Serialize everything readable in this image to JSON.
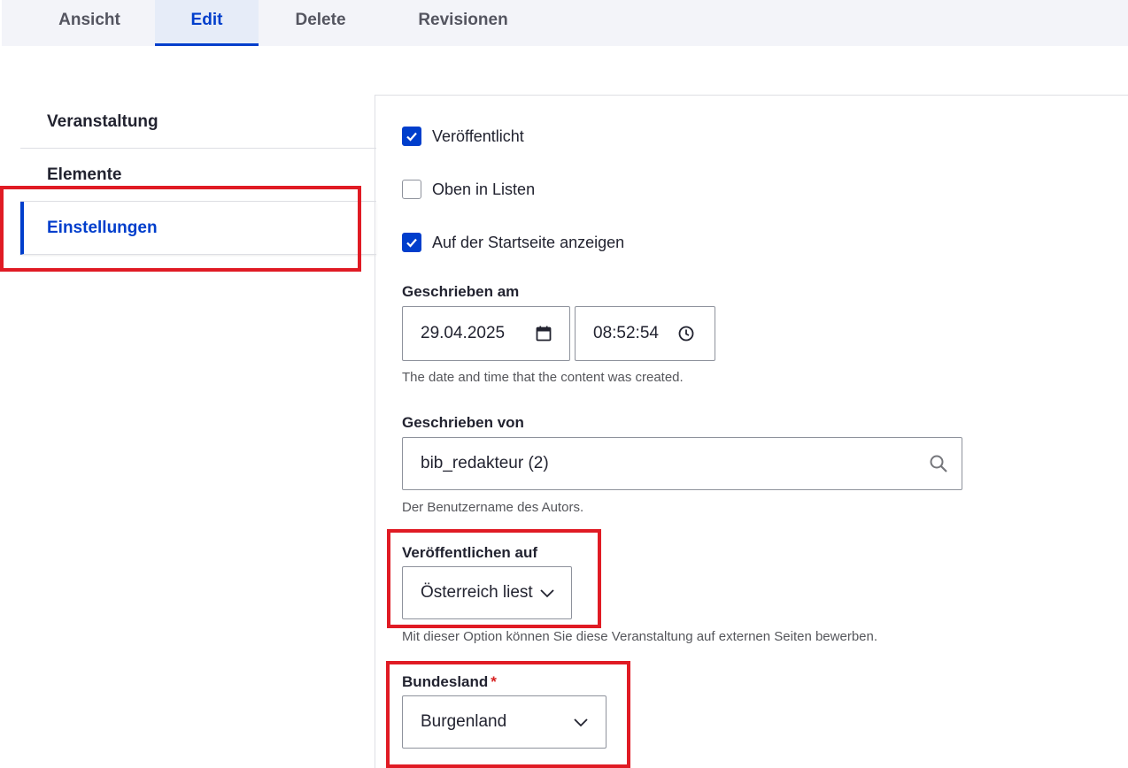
{
  "tabs": [
    {
      "label": "Ansicht",
      "active": false
    },
    {
      "label": "Edit",
      "active": true
    },
    {
      "label": "Delete",
      "active": false
    },
    {
      "label": "Revisionen",
      "active": false
    }
  ],
  "sidebar": {
    "items": [
      {
        "label": "Veranstaltung",
        "active": false
      },
      {
        "label": "Elemente",
        "active": false
      },
      {
        "label": "Einstellungen",
        "active": true
      }
    ]
  },
  "settings": {
    "published": {
      "label": "Veröffentlicht",
      "checked": true
    },
    "sticky": {
      "label": "Oben in Listen",
      "checked": false
    },
    "promote": {
      "label": "Auf der Startseite anzeigen",
      "checked": true
    },
    "created": {
      "label": "Geschrieben am",
      "date": "29.04.2025",
      "time": "08:52:54",
      "description": "The date and time that the content was created."
    },
    "author": {
      "label": "Geschrieben von",
      "value": "bib_redakteur (2)",
      "description": "Der Benutzername des Autors."
    },
    "publish_on": {
      "label": "Veröffentlichen auf",
      "value": "Österreich liest",
      "description": "Mit dieser Option können Sie diese Veranstaltung auf externen Seiten bewerben."
    },
    "state": {
      "label": "Bundesland",
      "required_marker": "*",
      "value": "Burgenland"
    }
  },
  "colors": {
    "accent": "#003ecc",
    "highlight": "#e01b24"
  }
}
